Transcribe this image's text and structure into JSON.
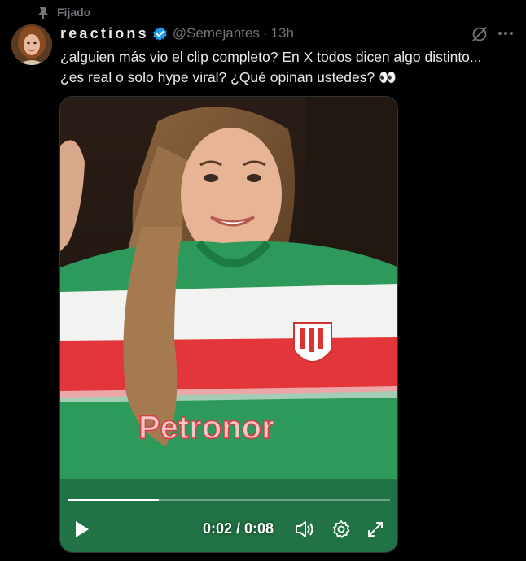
{
  "pinned": {
    "label": "Fijado",
    "icon": "pin-icon"
  },
  "author": {
    "display_name": "reactions",
    "handle": "@Semejantes",
    "separator": "·",
    "time": "13h",
    "verified_color": "#1d9bf0"
  },
  "post": {
    "text_line1": "¿alguien más vio el clip completo? En X todos dicen algo distinto...",
    "text_line2": "¿es real o solo hype viral? ¿Qué opinan ustedes? 👀"
  },
  "video": {
    "current_time": "0:02",
    "duration": "0:08",
    "timecode": "0:02 / 0:08",
    "progress_fraction": 0.28,
    "shirt_text": "Petronor"
  },
  "icons": {
    "grok": "grok-icon",
    "more": "more-icon",
    "play": "play-icon",
    "volume": "volume-icon",
    "settings": "settings-icon",
    "fullscreen": "fullscreen-icon"
  },
  "colors": {
    "background": "#000000",
    "text": "#e7e9ea",
    "muted": "#71767b",
    "accent": "#1d9bf0"
  }
}
